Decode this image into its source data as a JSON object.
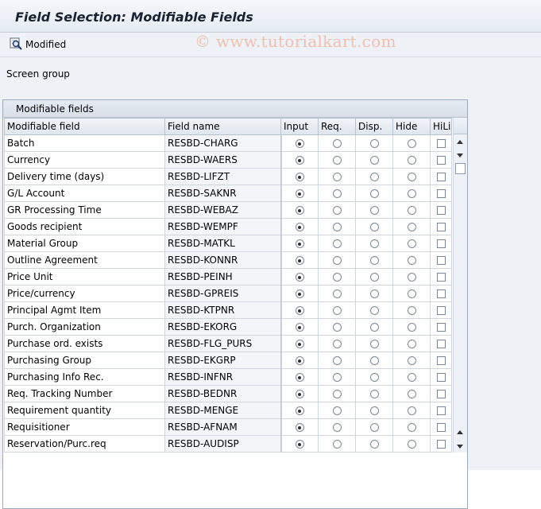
{
  "window": {
    "title": "Field Selection: Modifiable Fields"
  },
  "toolbar": {
    "modified_label": "Modified",
    "modified_icon": "magnifier-icon"
  },
  "watermark": "© www.tutorialkart.com",
  "screen_group_label": "Screen group",
  "panel": {
    "title": "Modifiable fields"
  },
  "table": {
    "columns": [
      "Modifiable field",
      "Field name",
      "Input",
      "Req.",
      "Disp.",
      "Hide",
      "HiLi"
    ],
    "rows": [
      {
        "field": "Batch",
        "name": "RESBD-CHARG",
        "selected": "Input",
        "hili": false
      },
      {
        "field": "Currency",
        "name": "RESBD-WAERS",
        "selected": "Input",
        "hili": false
      },
      {
        "field": "Delivery time (days)",
        "name": "RESBD-LIFZT",
        "selected": "Input",
        "hili": false
      },
      {
        "field": "G/L Account",
        "name": "RESBD-SAKNR",
        "selected": "Input",
        "hili": false
      },
      {
        "field": "GR Processing Time",
        "name": "RESBD-WEBAZ",
        "selected": "Input",
        "hili": false
      },
      {
        "field": "Goods recipient",
        "name": "RESBD-WEMPF",
        "selected": "Input",
        "hili": false
      },
      {
        "field": "Material Group",
        "name": "RESBD-MATKL",
        "selected": "Input",
        "hili": false
      },
      {
        "field": "Outline Agreement",
        "name": "RESBD-KONNR",
        "selected": "Input",
        "hili": false
      },
      {
        "field": "Price Unit",
        "name": "RESBD-PEINH",
        "selected": "Input",
        "hili": false
      },
      {
        "field": "Price/currency",
        "name": "RESBD-GPREIS",
        "selected": "Input",
        "hili": false
      },
      {
        "field": "Principal Agmt Item",
        "name": "RESBD-KTPNR",
        "selected": "Input",
        "hili": false
      },
      {
        "field": "Purch. Organization",
        "name": "RESBD-EKORG",
        "selected": "Input",
        "hili": false
      },
      {
        "field": "Purchase ord. exists",
        "name": "RESBD-FLG_PURS",
        "selected": "Input",
        "hili": false
      },
      {
        "field": "Purchasing Group",
        "name": "RESBD-EKGRP",
        "selected": "Input",
        "hili": false
      },
      {
        "field": "Purchasing Info Rec.",
        "name": "RESBD-INFNR",
        "selected": "Input",
        "hili": false
      },
      {
        "field": "Req. Tracking Number",
        "name": "RESBD-BEDNR",
        "selected": "Input",
        "hili": false
      },
      {
        "field": "Requirement quantity",
        "name": "RESBD-MENGE",
        "selected": "Input",
        "hili": false
      },
      {
        "field": "Requisitioner",
        "name": "RESBD-AFNAM",
        "selected": "Input",
        "hili": false
      },
      {
        "field": "Reservation/Purc.req",
        "name": "RESBD-AUDISP",
        "selected": "Input",
        "hili": false
      }
    ]
  }
}
